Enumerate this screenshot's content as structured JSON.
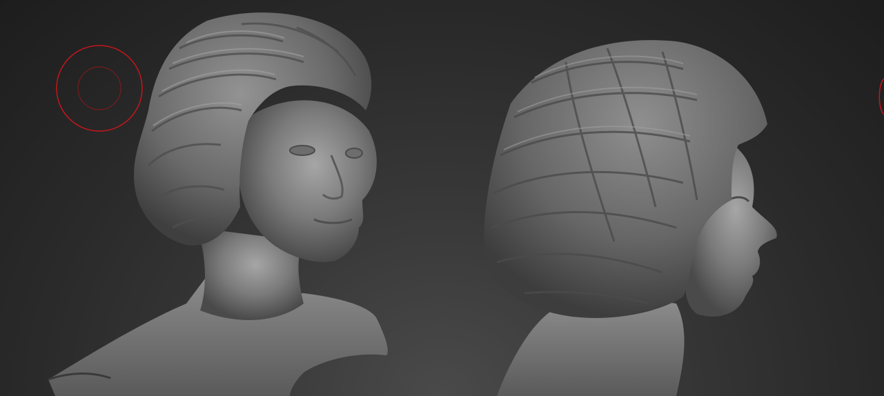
{
  "viewport": {
    "name": "zbrush-canvas",
    "background_color": "#2b2b2b",
    "model_color": "#8a8a8a",
    "brush_cursor_color": "#c4161c"
  },
  "models": [
    {
      "name": "bust-three-quarter-view"
    },
    {
      "name": "bust-side-view"
    }
  ],
  "cursors": [
    {
      "name": "brush-draw-size-cursor"
    },
    {
      "name": "brush-draw-size-cursor-partial"
    }
  ]
}
